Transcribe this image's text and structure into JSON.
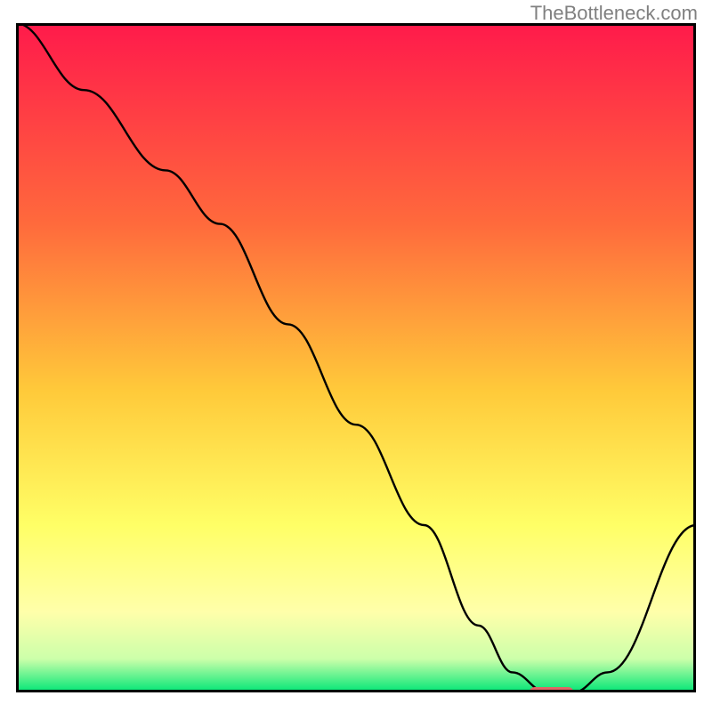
{
  "watermark": "TheBottleneck.com",
  "chart_data": {
    "type": "line",
    "title": "",
    "xlabel": "",
    "ylabel": "",
    "xlim": [
      0,
      100
    ],
    "ylim": [
      0,
      100
    ],
    "gradient_stops": [
      {
        "offset": 0,
        "color": "#ff1a4b"
      },
      {
        "offset": 30,
        "color": "#ff6a3c"
      },
      {
        "offset": 55,
        "color": "#ffca3a"
      },
      {
        "offset": 75,
        "color": "#ffff66"
      },
      {
        "offset": 88,
        "color": "#ffffaa"
      },
      {
        "offset": 95,
        "color": "#ccffaa"
      },
      {
        "offset": 100,
        "color": "#00e676"
      }
    ],
    "series": [
      {
        "name": "bottleneck-curve",
        "color": "#000000",
        "x": [
          0,
          10,
          22,
          30,
          40,
          50,
          60,
          68,
          73,
          78,
          82,
          87,
          100
        ],
        "values": [
          100,
          90,
          78,
          70,
          55,
          40,
          25,
          10,
          3,
          0,
          0,
          3,
          25
        ]
      }
    ],
    "marker": {
      "name": "target-marker",
      "color": "#e06666",
      "x_start": 75.5,
      "x_end": 82,
      "y": 0,
      "thickness_pct": 1.6
    },
    "axes": {
      "show_ticks": false,
      "show_grid": false
    }
  }
}
